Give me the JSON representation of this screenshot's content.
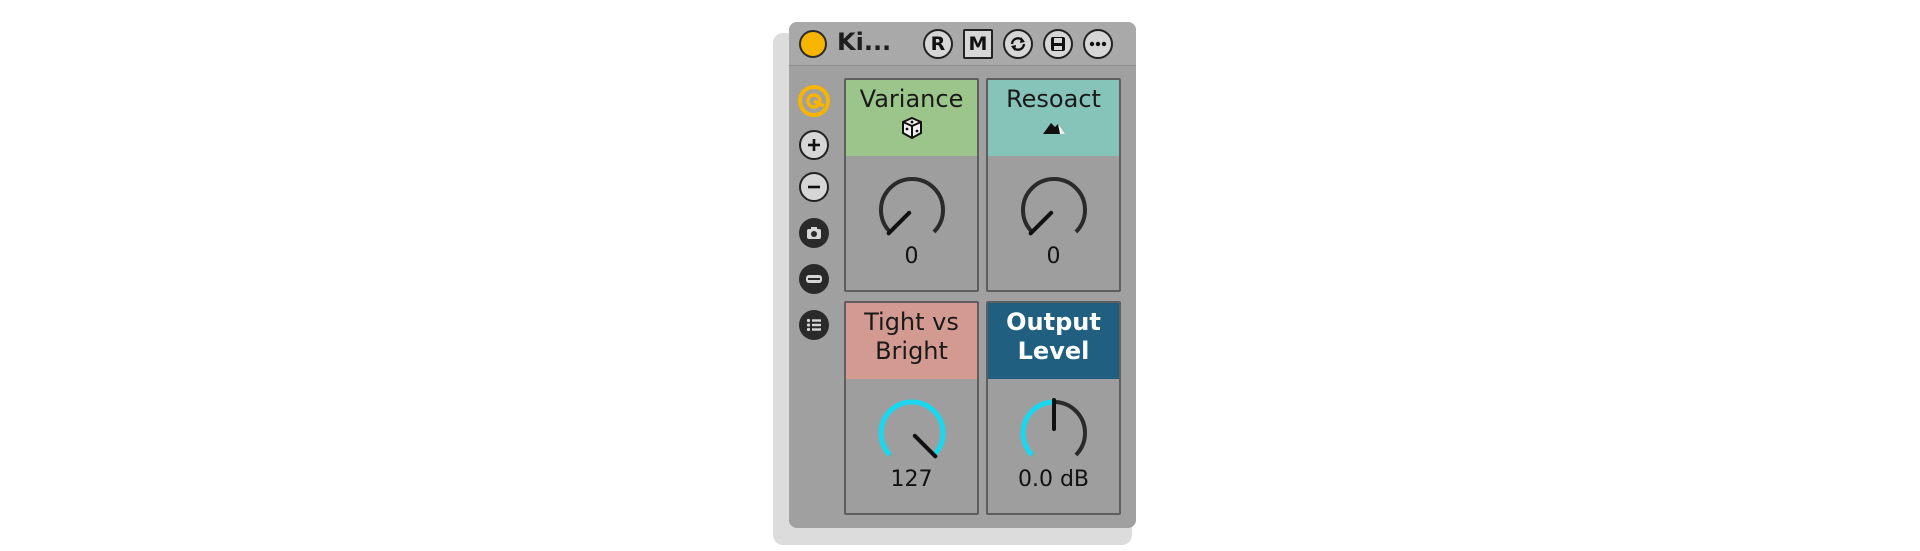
{
  "device": {
    "title": "Ki...",
    "header_buttons": [
      {
        "label": "R",
        "icon": "record-r-icon"
      },
      {
        "label": "M",
        "icon": "mute-m-icon"
      },
      {
        "label": "",
        "icon": "refresh-icon"
      },
      {
        "label": "",
        "icon": "save-icon"
      },
      {
        "label": "",
        "icon": "more-icon"
      }
    ],
    "power_color": "#f7b500"
  },
  "sidebar": {
    "items": [
      "macro-power-icon",
      "plus-icon",
      "minus-icon",
      "camera-icon",
      "randomize-icon",
      "list-icon"
    ],
    "accent": "#f7b500"
  },
  "macros": [
    {
      "label": "Variance",
      "value": "0",
      "header_color": "#9cc58b",
      "label_color": "#1a1a1a",
      "icon": "dice-icon",
      "level": 0.0
    },
    {
      "label": "Resoact",
      "value": "0",
      "header_color": "#86c3b9",
      "label_color": "#1a1a1a",
      "icon": "mountain-icon",
      "level": 0.0
    },
    {
      "label": "Tight vs Bright",
      "value": "127",
      "header_color": "#d39a92",
      "label_color": "#1a1a1a",
      "icon": "",
      "level": 1.0
    },
    {
      "label": "Output Level",
      "value": "0.0 dB",
      "header_color": "#205f80",
      "label_color": "#ffffff",
      "icon": "",
      "level": 0.5
    }
  ],
  "knob_arc_color": "#19d7ef"
}
